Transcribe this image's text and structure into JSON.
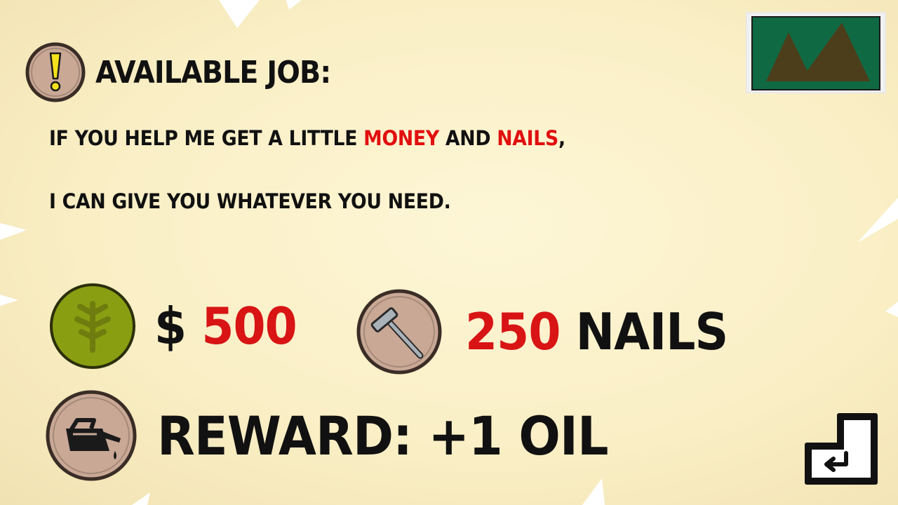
{
  "header": {
    "title": "AVAILABLE JOB:"
  },
  "message": {
    "line1_part1": "IF YOU HELP ME GET A LITTLE ",
    "line1_highlight1": "MONEY",
    "line1_part2": " AND ",
    "line1_highlight2": "NAILS",
    "line1_part3": ",",
    "line2": "I CAN GIVE YOU WHATEVER YOU NEED."
  },
  "requirements": {
    "money": {
      "currency": "$",
      "amount": "500",
      "icon": "money-tree-icon"
    },
    "nails": {
      "amount": "250",
      "label": "NAILS",
      "icon": "nail-icon"
    }
  },
  "reward": {
    "text": "REWARD: +1 OIL",
    "icon": "oil-can-icon"
  },
  "controls": {
    "enter_icon": "enter-key-icon"
  },
  "colors": {
    "highlight": "#e10f0f",
    "amount_red": "#d81414",
    "money_badge": "#8a9e12",
    "badge_fill": "#c9a896",
    "stamp_green": "#0f6a44"
  }
}
